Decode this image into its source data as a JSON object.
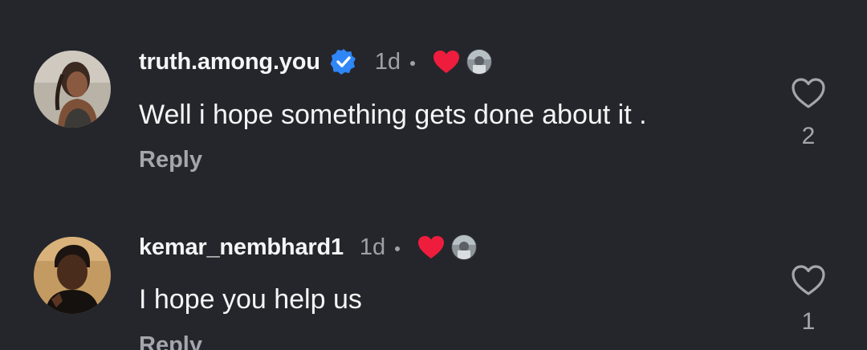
{
  "comments": [
    {
      "username": "truth.among.you",
      "verified": true,
      "time": "1d",
      "text": "Well i hope something gets done about it .",
      "reply_label": "Reply",
      "likes": "2"
    },
    {
      "username": "kemar_nembhard1",
      "verified": false,
      "time": "1d",
      "text": "I hope you help us",
      "reply_label": "Reply",
      "likes": "1"
    }
  ],
  "colors": {
    "background": "#25262b",
    "verified_blue": "#2f86f7",
    "creator_heart": "#ee1d3d",
    "muted_text": "#a3a7ad"
  },
  "icons": {
    "verified": "verified-badge-icon",
    "creator_liked": "red-heart-icon",
    "like": "heart-outline-icon"
  }
}
